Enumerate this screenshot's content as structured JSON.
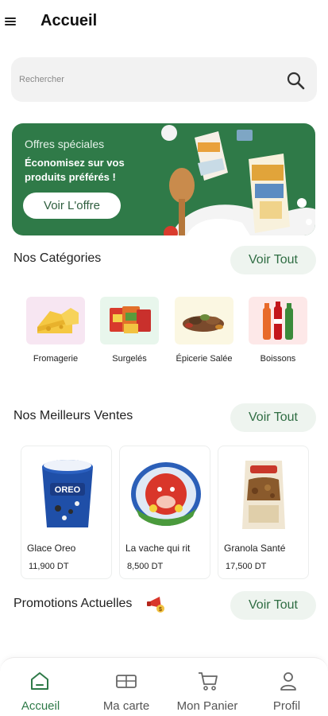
{
  "header": {
    "title": "Accueil"
  },
  "search": {
    "placeholder": "Rechercher"
  },
  "banner": {
    "subtitle": "Offres spéciales",
    "title": "Économisez sur vos produits préférés !",
    "button": "Voir L'offre"
  },
  "categories_section": {
    "title": "Nos Catégories",
    "see_all": "Voir Tout",
    "items": [
      {
        "label": "Fromagerie"
      },
      {
        "label": "Surgelés"
      },
      {
        "label": "Épicerie Salée"
      },
      {
        "label": "Boissons"
      }
    ]
  },
  "bestsellers_section": {
    "title": "Nos Meilleurs Ventes",
    "see_all": "Voir Tout",
    "items": [
      {
        "name": "Glace Oreo",
        "price": "11,900 DT"
      },
      {
        "name": "La vache qui rit",
        "price": "8,500 DT"
      },
      {
        "name": "Granola Santé",
        "price": "17,500 DT"
      }
    ]
  },
  "promotions_section": {
    "title": "Promotions Actuelles",
    "see_all": "Voir Tout"
  },
  "bottom_nav": {
    "items": [
      {
        "label": "Accueil",
        "icon": "home-icon",
        "active": true
      },
      {
        "label": "Ma carte",
        "icon": "card-icon"
      },
      {
        "label": "Mon Panier",
        "icon": "cart-icon"
      },
      {
        "label": "Profil",
        "icon": "profile-icon"
      }
    ]
  },
  "colors": {
    "accent": "#2f7a48",
    "banner": "#2f7a48",
    "pill": "#eef4ef"
  }
}
